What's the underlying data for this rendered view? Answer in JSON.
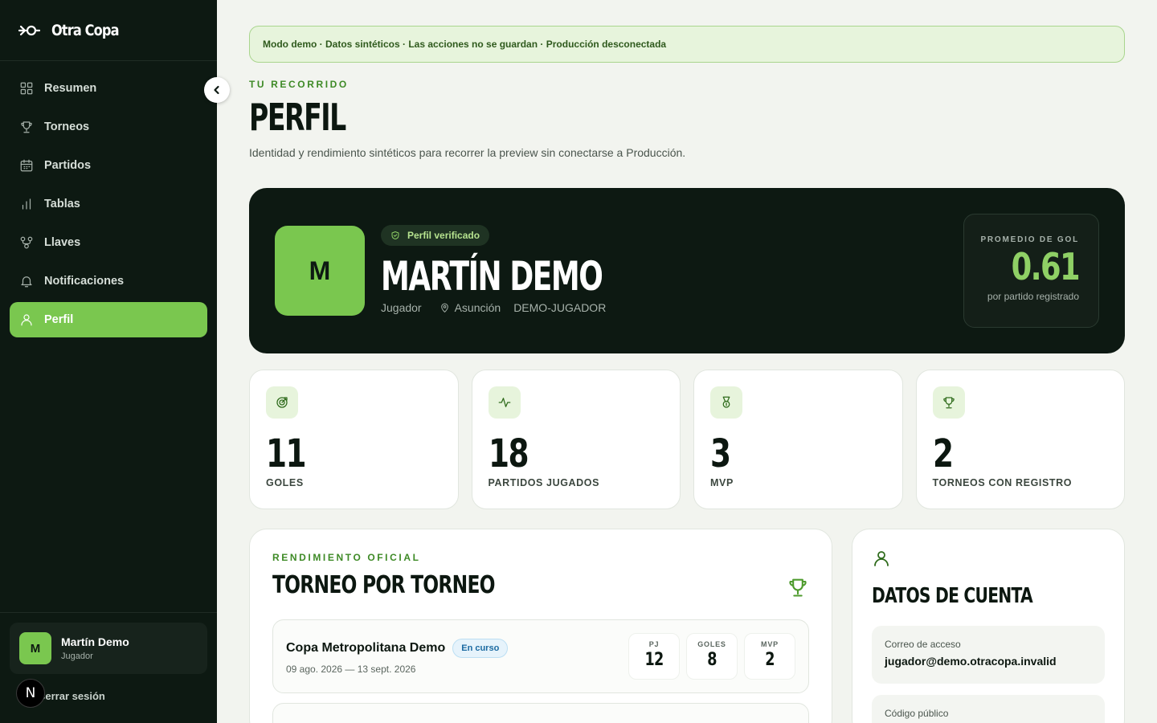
{
  "app": {
    "name": "Otra Copa",
    "colors": {
      "sidebar_bg": "#0d1912",
      "accent": "#7ac74f",
      "page_bg": "#f2f4ef",
      "info": "#1b6aa1"
    }
  },
  "sidebar": {
    "items": [
      {
        "label": "Resumen",
        "icon": "grid-icon"
      },
      {
        "label": "Torneos",
        "icon": "trophy-icon"
      },
      {
        "label": "Partidos",
        "icon": "calendar-icon"
      },
      {
        "label": "Tablas",
        "icon": "bar-chart-icon"
      },
      {
        "label": "Llaves",
        "icon": "bracket-icon"
      },
      {
        "label": "Notificaciones",
        "icon": "bell-icon"
      },
      {
        "label": "Perfil",
        "icon": "user-icon",
        "active": true
      }
    ],
    "user": {
      "initial": "M",
      "name": "Martín Demo",
      "role": "Jugador"
    },
    "logout_label": "Cerrar sesión",
    "badge_letter": "N"
  },
  "banner": {
    "text": "Modo demo · Datos sintéticos · Las acciones no se guardan · Producción desconectada"
  },
  "header": {
    "eyebrow": "TU RECORRIDO",
    "title": "PERFIL",
    "subtitle": "Identidad y rendimiento sintéticos para recorrer la preview sin conectarse a Producción."
  },
  "profile": {
    "initial": "M",
    "verified_label": "Perfil verificado",
    "name": "MARTÍN DEMO",
    "role": "Jugador",
    "city": "Asunción",
    "code": "DEMO-JUGADOR",
    "average": {
      "label": "PROMEDIO DE GOL",
      "value": "0.61",
      "sub": "por partido registrado"
    }
  },
  "stats": [
    {
      "value": "11",
      "label": "GOLES",
      "icon": "target-icon"
    },
    {
      "value": "18",
      "label": "PARTIDOS JUGADOS",
      "icon": "activity-icon"
    },
    {
      "value": "3",
      "label": "MVP",
      "icon": "medal-icon"
    },
    {
      "value": "2",
      "label": "TORNEOS CON REGISTRO",
      "icon": "trophy-icon"
    }
  ],
  "tournaments": {
    "eyebrow": "RENDIMIENTO OFICIAL",
    "title": "TORNEO POR TORNEO",
    "rows": [
      {
        "name": "Copa Metropolitana Demo",
        "status": "En curso",
        "dates": "09 ago. 2026 — 13 sept. 2026",
        "pj_label": "PJ",
        "pj": "12",
        "goles_label": "GOLES",
        "goles": "8",
        "mvp_label": "MVP",
        "mvp": "2"
      }
    ]
  },
  "account": {
    "title": "DATOS DE CUENTA",
    "email_label": "Correo de acceso",
    "email": "jugador@demo.otracopa.invalid",
    "code_label": "Código público"
  }
}
